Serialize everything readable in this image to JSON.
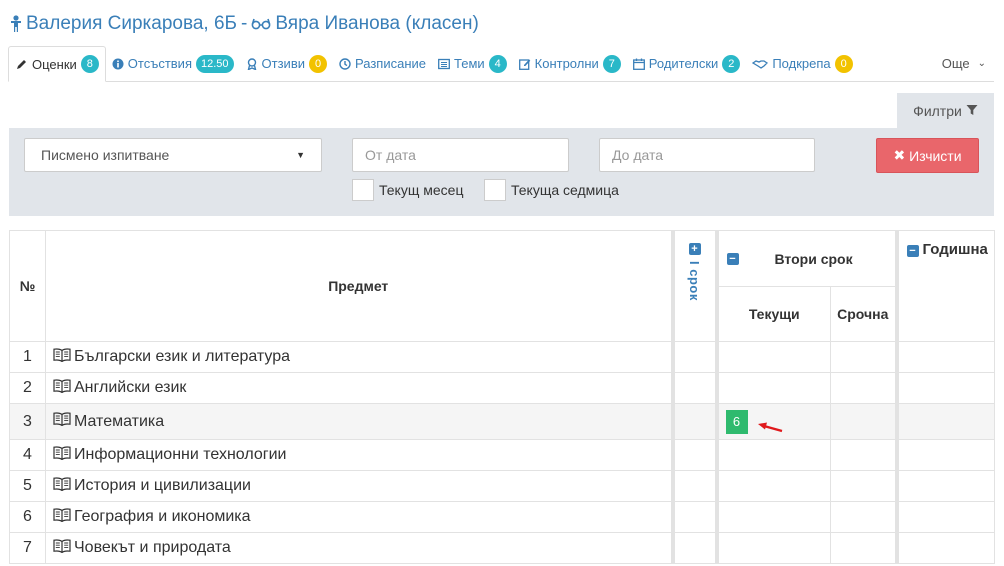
{
  "header": {
    "student": "Валерия Сиркарова, 6Б",
    "separator": "-",
    "teacher": "Вяра Иванова (класен)"
  },
  "tabs": [
    {
      "label": "Оценки",
      "badge": "8",
      "icon": "pencil-icon",
      "badge_color": "#2ab8c8"
    },
    {
      "label": "Отсъствия",
      "badge": "12.50",
      "icon": "info-icon",
      "badge_color": "#2ab8c8"
    },
    {
      "label": "Отзиви",
      "badge": "0",
      "icon": "award-icon",
      "badge_color": "#f2c200"
    },
    {
      "label": "Разписание",
      "badge": "",
      "icon": "clock-icon"
    },
    {
      "label": "Теми",
      "badge": "4",
      "icon": "list-icon",
      "badge_color": "#2ab8c8"
    },
    {
      "label": "Контролни",
      "badge": "7",
      "icon": "edit-icon",
      "badge_color": "#2ab8c8"
    },
    {
      "label": "Родителски",
      "badge": "2",
      "icon": "calendar-icon",
      "badge_color": "#2ab8c8"
    },
    {
      "label": "Подкрепа",
      "badge": "0",
      "icon": "handshake-icon",
      "badge_color": "#f2c200"
    }
  ],
  "more_label": "Още",
  "filters": {
    "toggle_label": "Филтри",
    "select_value": "Писмено изпитване",
    "from_placeholder": "От дата",
    "to_placeholder": "До дата",
    "current_month": "Текущ месец",
    "current_week": "Текуща седмица",
    "clear_label": "Изчисти",
    "clear_color": "#e9666b"
  },
  "table": {
    "col_no": "№",
    "col_subject": "Предмет",
    "term1": "I срок",
    "term2": "Втори срок",
    "term2_current": "Текущи",
    "term2_urgent": "Срочна",
    "year": "Годишна",
    "rows": [
      {
        "no": "1",
        "subject": "Български език и литература",
        "grade": ""
      },
      {
        "no": "2",
        "subject": "Английски език",
        "grade": ""
      },
      {
        "no": "3",
        "subject": "Математика",
        "grade": "6"
      },
      {
        "no": "4",
        "subject": "Информационни технологии",
        "grade": ""
      },
      {
        "no": "5",
        "subject": "История и цивилизации",
        "grade": ""
      },
      {
        "no": "6",
        "subject": "География и икономика",
        "grade": ""
      },
      {
        "no": "7",
        "subject": "Човекът и природата",
        "grade": ""
      }
    ]
  },
  "colors": {
    "link": "#3a7fb8",
    "grade_bg": "#2fba6e",
    "panel_bg": "#e1e5ea",
    "arrow": "#e0191c"
  }
}
